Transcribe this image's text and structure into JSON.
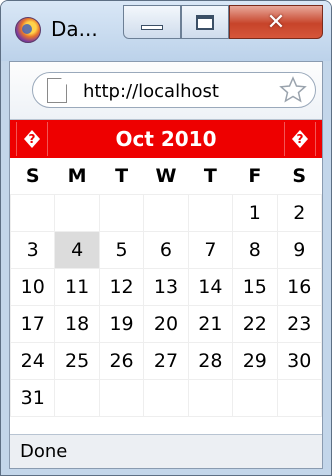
{
  "window": {
    "title": "Da..."
  },
  "address_bar": {
    "url": "http://localhost"
  },
  "calendar": {
    "prev_glyph": "?",
    "next_glyph": "?",
    "month_label": "Oct 2010",
    "weekdays": [
      "S",
      "M",
      "T",
      "W",
      "T",
      "F",
      "S"
    ],
    "weeks": [
      [
        "",
        "",
        "",
        "",
        "",
        "1",
        "2"
      ],
      [
        "3",
        "4",
        "5",
        "6",
        "7",
        "8",
        "9"
      ],
      [
        "10",
        "11",
        "12",
        "13",
        "14",
        "15",
        "16"
      ],
      [
        "17",
        "18",
        "19",
        "20",
        "21",
        "22",
        "23"
      ],
      [
        "24",
        "25",
        "26",
        "27",
        "28",
        "29",
        "30"
      ],
      [
        "31",
        "",
        "",
        "",
        "",
        "",
        ""
      ]
    ],
    "highlighted_day": "4",
    "header_color": "#ee0000"
  },
  "status_bar": {
    "text": "Done"
  }
}
